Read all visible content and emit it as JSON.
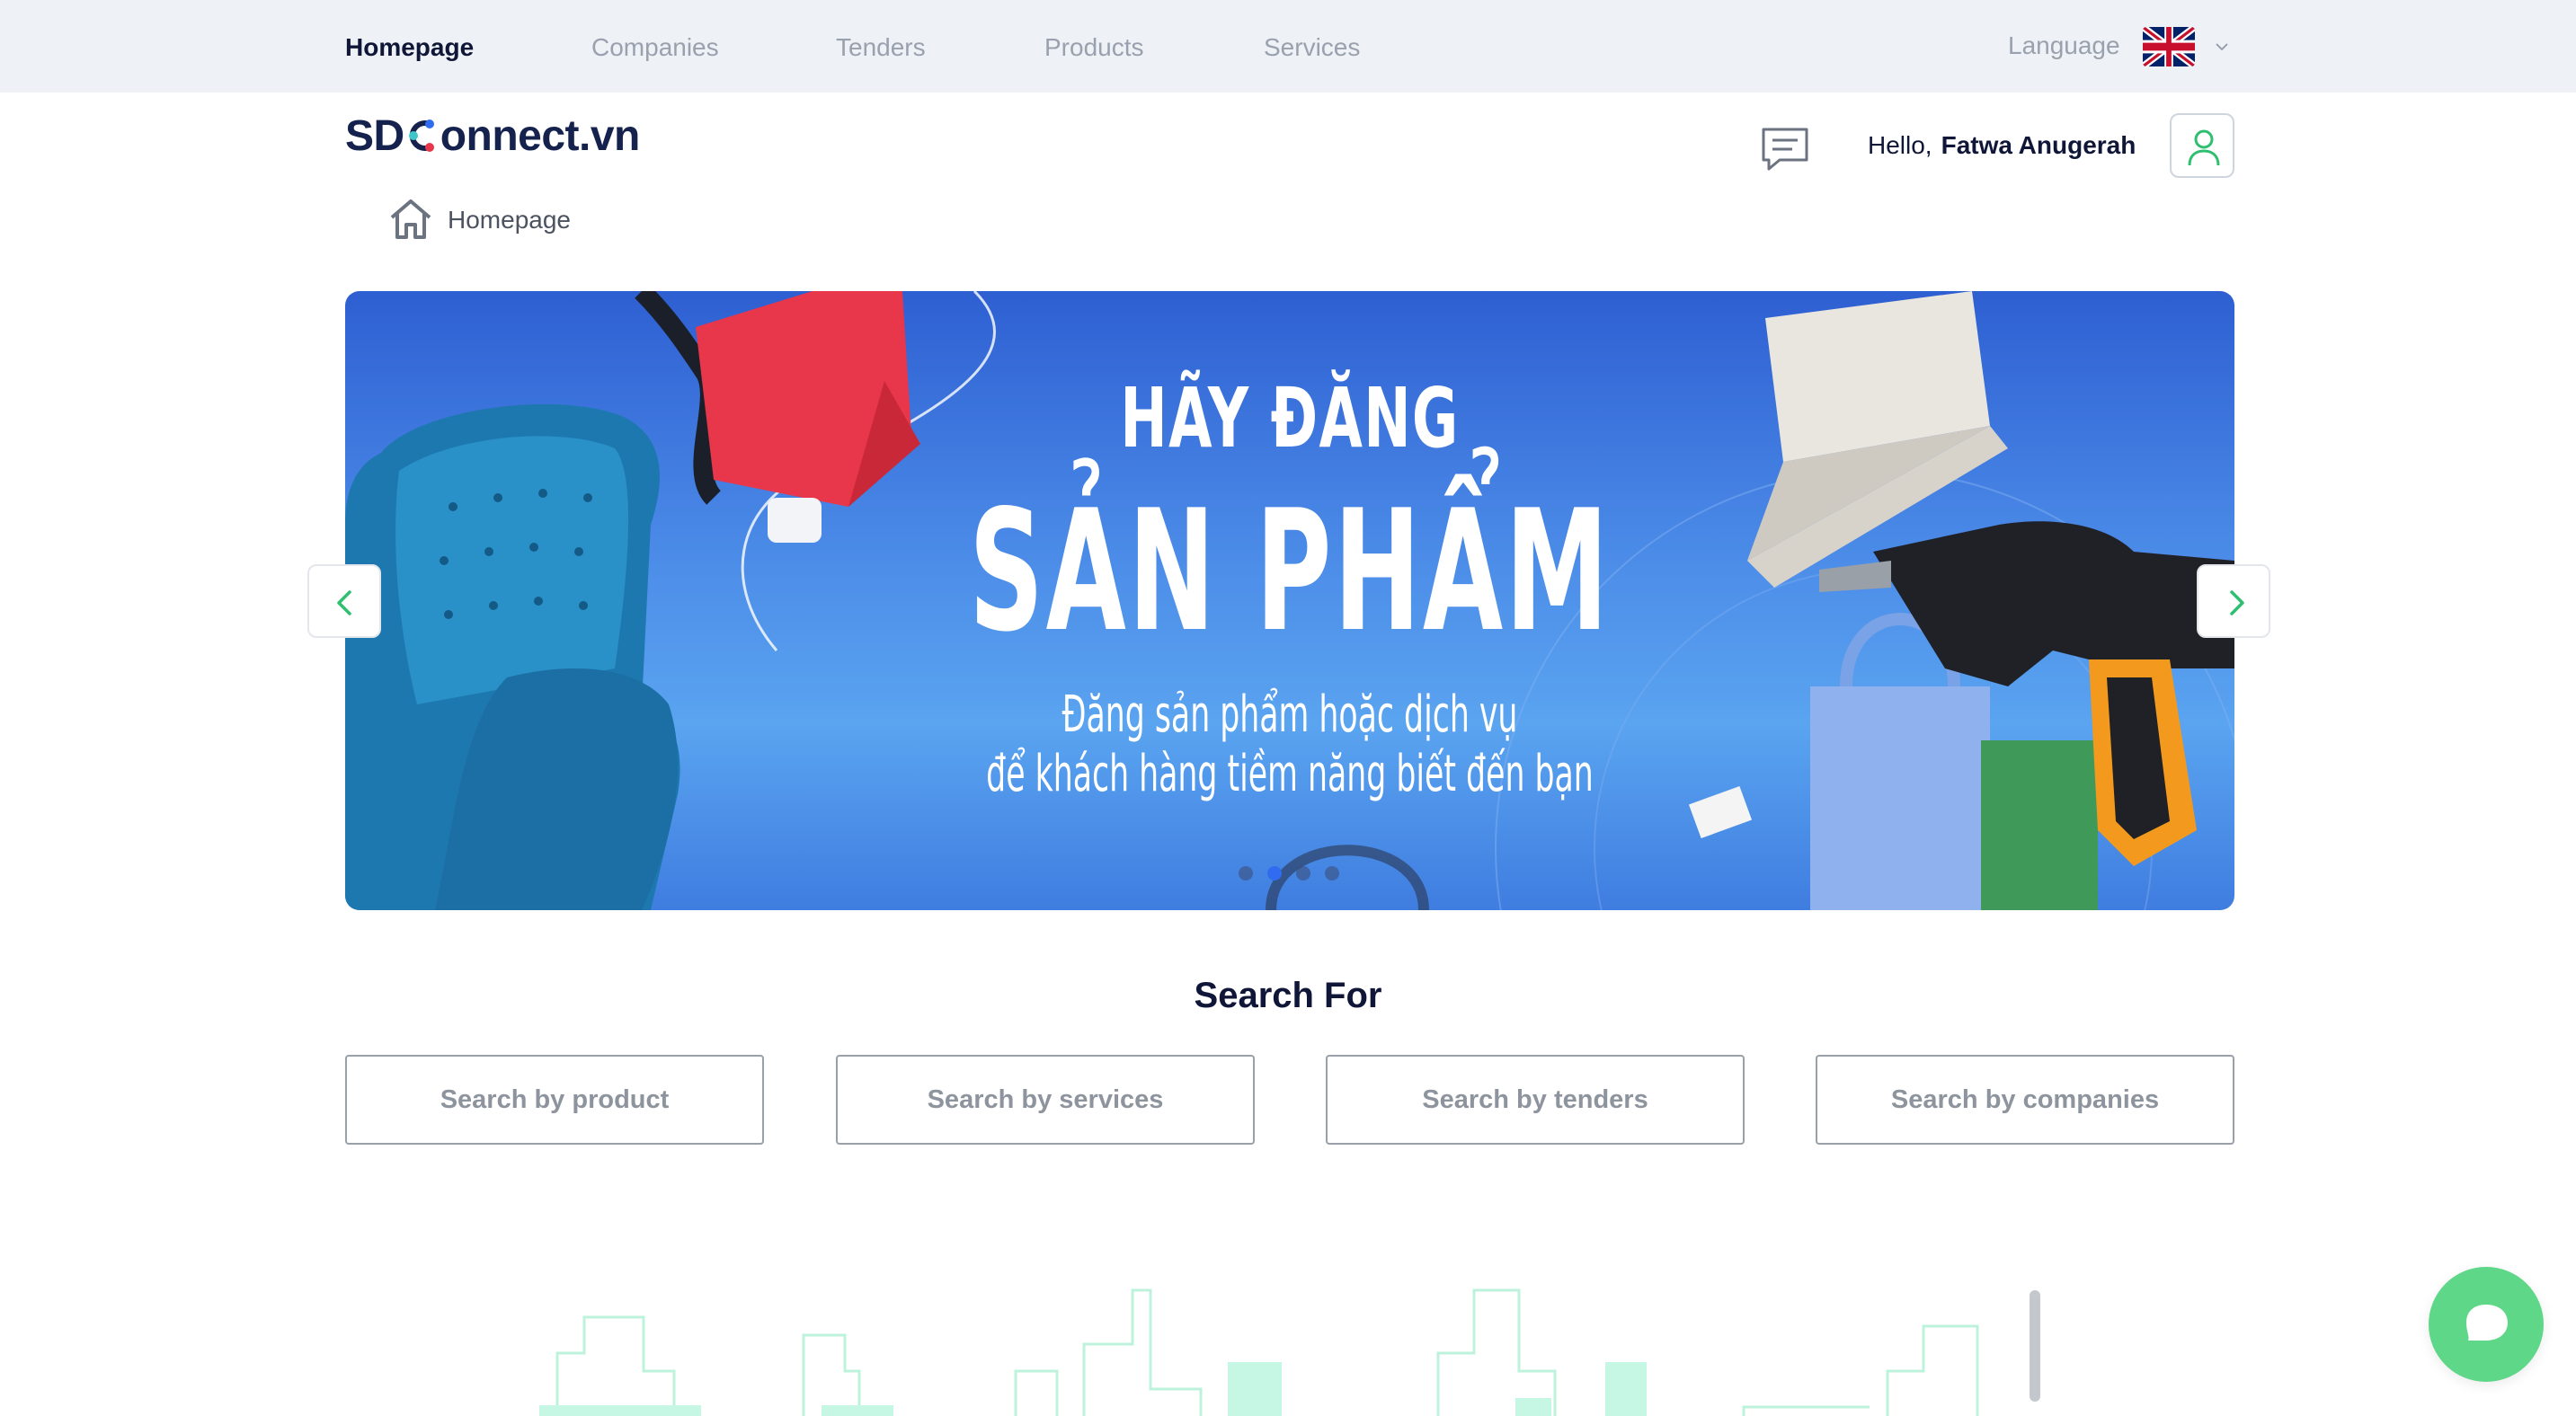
{
  "nav": {
    "items": [
      {
        "label": "Homepage",
        "active": true
      },
      {
        "label": "Companies",
        "active": false
      },
      {
        "label": "Tenders",
        "active": false
      },
      {
        "label": "Products",
        "active": false
      },
      {
        "label": "Services",
        "active": false
      }
    ],
    "language_label": "Language",
    "language_flag": "uk-flag-icon"
  },
  "header": {
    "logo_prefix": "SD",
    "logo_suffix": "onnect.vn",
    "greeting": "Hello,",
    "user_name": "Fatwa Anugerah"
  },
  "breadcrumb": {
    "home_label": "Homepage"
  },
  "banner": {
    "title_line1": "HÃY ĐĂNG",
    "title_line2": "SẢN PHẨM",
    "subtitle_line1": "Đăng sản phẩm hoặc dịch vụ",
    "subtitle_line2": "để khách hàng tiềm năng biết đến bạn",
    "slide_count": 4,
    "active_slide": 2
  },
  "search": {
    "title": "Search For",
    "buttons": [
      {
        "label": "Search by product"
      },
      {
        "label": "Search by services"
      },
      {
        "label": "Search by tenders"
      },
      {
        "label": "Search by companies"
      }
    ]
  },
  "colors": {
    "accent_green": "#5fd788",
    "nav_bg": "#eef1f5",
    "text_dark": "#0f1637",
    "text_muted": "#9aa1ae"
  }
}
